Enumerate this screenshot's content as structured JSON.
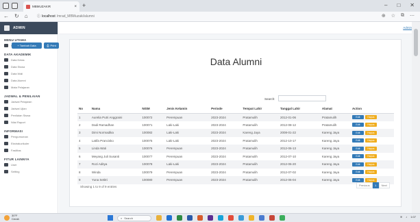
{
  "browser": {
    "tab_title": "MBMUZAKIR",
    "new_tab": "+",
    "url_host": "localhost",
    "url_path": "/mrad_MBMuzaki/alumni",
    "window_controls": [
      "–",
      "□",
      "✕"
    ]
  },
  "sidebar": {
    "brand": "ADMIN",
    "sections": [
      {
        "title": "MENU UTAMA",
        "items": [
          {
            "label": "Home",
            "icon": "home-icon"
          }
        ]
      },
      {
        "title": "DATA AKADEMIK",
        "items": [
          {
            "label": "Data Kelas",
            "icon": "class-icon"
          },
          {
            "label": "Data Siswa",
            "icon": "student-icon"
          },
          {
            "label": "Data Wali",
            "icon": "guardian-icon"
          },
          {
            "label": "Data Alumni",
            "icon": "alumni-icon"
          },
          {
            "label": "Mata Pelajaran",
            "icon": "subject-icon"
          }
        ]
      },
      {
        "title": "JADWAL & PENILAIAN",
        "items": [
          {
            "label": "Jadwal Pelajaran",
            "icon": "schedule-icon"
          },
          {
            "label": "Jadwal Ujian",
            "icon": "exam-icon"
          },
          {
            "label": "Penilaian Siswa",
            "icon": "grade-icon"
          },
          {
            "label": "Nilai Raport",
            "icon": "report-icon"
          }
        ]
      },
      {
        "title": "INFORMASI",
        "items": [
          {
            "label": "Pengumuman",
            "icon": "announcement-icon"
          },
          {
            "label": "Ekstrakurikuler",
            "icon": "extracurricular-icon"
          },
          {
            "label": "Fasilitas",
            "icon": "facility-icon"
          }
        ]
      },
      {
        "title": "FITUR LAINNYA",
        "items": [
          {
            "label": "User",
            "icon": "user-icon"
          },
          {
            "label": "Setting",
            "icon": "setting-icon"
          }
        ]
      }
    ]
  },
  "header": {
    "user_link": "Admin"
  },
  "page": {
    "title": "Data Alumni",
    "add_button": "+ Tambah Data",
    "print_button": "Print",
    "search_label": "Search:",
    "search_value": "",
    "columns": [
      "No",
      "Nama",
      "NISM",
      "Jenis Kelamin",
      "Periode",
      "Tempat Lahir",
      "Tanggal Lahir",
      "Alamat",
      "Action"
    ],
    "rows": [
      [
        "1",
        "Aurelia Putri Anggraini",
        "100072",
        "Perempuan",
        "2023-2024",
        "Pratamulih",
        "2012-01-06",
        "Pratamulih"
      ],
      [
        "2",
        "Dadi Ramadhan",
        "100071",
        "Laki-Laki",
        "2023-2024",
        "Pratamulih",
        "2012-08-12",
        "Pratamulih"
      ],
      [
        "3",
        "Dimi Normadika",
        "100082",
        "Laki-Laki",
        "2023-2024",
        "Kareng Jaya",
        "2008-01-22",
        "Kareng Jaya"
      ],
      [
        "4",
        "Latifa Prancisko",
        "100075",
        "Laki-Laki",
        "2023-2024",
        "Pratamulih",
        "2012-10-17",
        "Kareng Jaya"
      ],
      [
        "5",
        "Linda Wati",
        "100076",
        "Perempuan",
        "2023-2024",
        "Pratamulih",
        "2012-06-13",
        "Kareng Jaya"
      ],
      [
        "6",
        "Meyang Juli Susanti",
        "100077",
        "Perempuan",
        "2023-2024",
        "Pratamulih",
        "2012-07-10",
        "Kareng Jaya"
      ],
      [
        "7",
        "Rozi Aditya",
        "100078",
        "Laki-Laki",
        "2023-2024",
        "Pratamulih",
        "2012-06-20",
        "Kareng Jaya"
      ],
      [
        "8",
        "Winda",
        "100079",
        "Perempuan",
        "2023-2024",
        "Pratamulih",
        "2012-07-02",
        "Kareng Jaya"
      ],
      [
        "9",
        "Yuna Setitri",
        "100080",
        "Perempuan",
        "2023-2024",
        "Pratamulih",
        "2012-06-04",
        "Kareng Jaya"
      ]
    ],
    "edit_label": "Edit",
    "delete_label": "Hapus",
    "info": "Showing 1 to 9 of 9 entries",
    "pager": {
      "prev": "Previous",
      "current": "1",
      "next": "Next"
    }
  },
  "taskbar": {
    "weather_temp": "30°F",
    "weather_desc": "Cerah",
    "search_placeholder": "Search",
    "time": "1:07"
  },
  "colors": {
    "primary": "#337ab7",
    "warning": "#f0ad1e",
    "brand_bar": "#3c4a5c"
  }
}
